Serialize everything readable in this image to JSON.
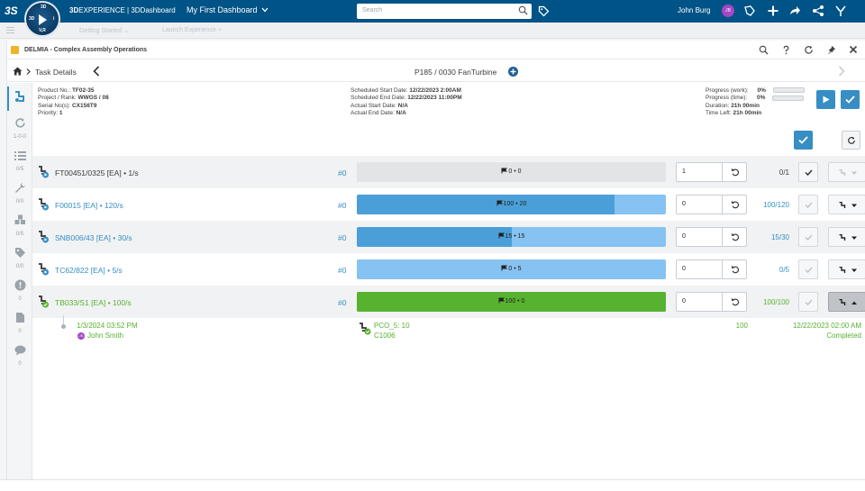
{
  "topbar": {
    "ds_logo": "3S",
    "compass_labels": {
      "top": "3D",
      "left": "3D",
      "right": "i",
      "bottom": "V,R"
    },
    "brand_strong": "3D",
    "brand_rest": "EXPERIENCE | 3DDashboard",
    "dashboard_name": "My First Dashboard",
    "search_placeholder": "Search",
    "user_name": "John Burg",
    "user_initials": "JB"
  },
  "strip": {
    "tab1": "Getting Started",
    "tab2": "Launch Experience"
  },
  "widget": {
    "title": "DELMIA - Complex Assembly Operations"
  },
  "nav": {
    "section": "Task Details",
    "task_title": "P185 / 0030 FanTurbine"
  },
  "sidebar": {
    "items": [
      {
        "icon": "operation-icon",
        "count": ""
      },
      {
        "icon": "refresh-icon",
        "count": "1-0-0"
      },
      {
        "icon": "list-icon",
        "count": "0/5"
      },
      {
        "icon": "wrench-icon",
        "count": "0/0"
      },
      {
        "icon": "parts-icon",
        "count": "0/5"
      },
      {
        "icon": "tag-icon",
        "count": "0/0"
      },
      {
        "icon": "alert-icon",
        "count": "0"
      },
      {
        "icon": "document-icon",
        "count": "0"
      },
      {
        "icon": "comment-icon",
        "count": "0"
      }
    ]
  },
  "details": {
    "product_no_label": "Product No.:",
    "product_no": "TF02-35",
    "project_label": "Project / Rank:",
    "project": "WWGS / 08",
    "serial_label": "Serial No(s):",
    "serial": "CX156T9",
    "priority_label": "Priority:",
    "priority": "1",
    "sched_start_label": "Scheduled Start Date:",
    "sched_start": "12/22/2023 2:00AM",
    "sched_end_label": "Scheduled End Date:",
    "sched_end": "12/22/2023 11:00PM",
    "actual_start_label": "Actual Start Date:",
    "actual_start": "N/A",
    "actual_end_label": "Actual End Date:",
    "actual_end": "N/A",
    "progress_work_label": "Progress (work):",
    "progress_work": "0%",
    "progress_work_value": 0,
    "progress_time_label": "Progress (time):",
    "progress_time": "0%",
    "progress_time_value": 0,
    "duration_label": "Duration:",
    "duration": "21h 00min",
    "time_left_label": "Time Left:",
    "time_left": "21h 00min"
  },
  "rows": [
    {
      "label": "FT00451/0325 [EA] • 1/s",
      "num": "#0",
      "bar_text": "0 • 0",
      "fill": 0,
      "fill_color": "#368ec4",
      "track_color": "#e2e4e6",
      "input": "1",
      "ratio": "0/1",
      "label_color": "#3d3d3d",
      "ratio_color": "#3d3d3d",
      "status": "blue"
    },
    {
      "label": "F00015 [EA] • 120/s",
      "num": "#0",
      "bar_text": "100 • 20",
      "fill": 0.8333,
      "fill_color": "#4a9fd8",
      "track_color": "#86c2f2",
      "input": "0",
      "ratio": "100/120",
      "label_color": "#368ec4",
      "ratio_color": "#368ec4",
      "status": "blue"
    },
    {
      "label": "SNB006/43 [EA] • 30/s",
      "num": "#0",
      "bar_text": "15 • 15",
      "fill": 0.5,
      "fill_color": "#4a9fd8",
      "track_color": "#86c2f2",
      "input": "0",
      "ratio": "15/30",
      "label_color": "#368ec4",
      "ratio_color": "#368ec4",
      "status": "blue"
    },
    {
      "label": "TC62/822 [EA] • 5/s",
      "num": "#0",
      "bar_text": "0 • 5",
      "fill": 0,
      "fill_color": "#4a9fd8",
      "track_color": "#86c2f2",
      "input": "0",
      "ratio": "0/5",
      "label_color": "#368ec4",
      "ratio_color": "#368ec4",
      "status": "blue"
    },
    {
      "label": "TB033/S1 [EA] • 100/s",
      "num": "#0",
      "bar_text": "100 • 0",
      "fill": 1,
      "fill_color": "#57b230",
      "track_color": "#57b230",
      "input": "0",
      "ratio": "100/100",
      "label_color": "#57b230",
      "ratio_color": "#57b230",
      "status": "green"
    }
  ],
  "detail": {
    "date": "1/3/2024 03:52 PM",
    "user_initials": "JS",
    "user": "John Smith",
    "po": "PCO_5: 10",
    "code": "C1006",
    "qty": "100",
    "completed_date": "12/22/2023 02:00 AM",
    "status": "Completed"
  },
  "colors": {
    "header": "#005386",
    "accent": "#368ec4",
    "success": "#57b230",
    "avatar": "#a347c7"
  }
}
